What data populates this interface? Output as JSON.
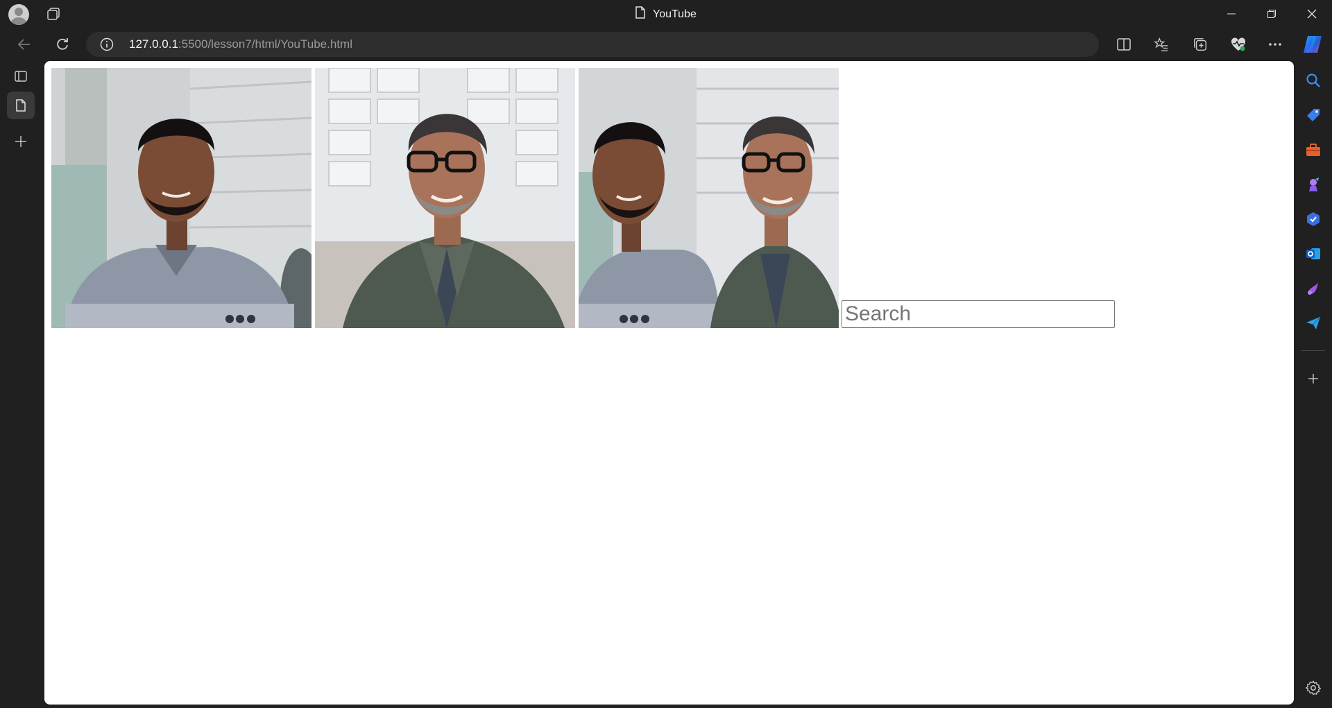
{
  "window": {
    "title": "YouTube"
  },
  "address_bar": {
    "host": "127.0.0.1",
    "path": ":5500/lesson7/html/YouTube.html"
  },
  "page": {
    "search": {
      "placeholder": "Search",
      "value": ""
    },
    "thumbnails": [
      {
        "name": "thumbnail-1"
      },
      {
        "name": "thumbnail-2"
      },
      {
        "name": "thumbnail-3"
      }
    ]
  },
  "sidebar_icons": [
    "search-icon",
    "shopping-tag-icon",
    "tools-icon",
    "games-icon",
    "copilot-icon",
    "outlook-icon",
    "drop-icon",
    "send-icon"
  ],
  "colors": {
    "chrome_background": "#202020",
    "address_bar_background": "#2e2e2e",
    "page_background": "#ffffff"
  }
}
